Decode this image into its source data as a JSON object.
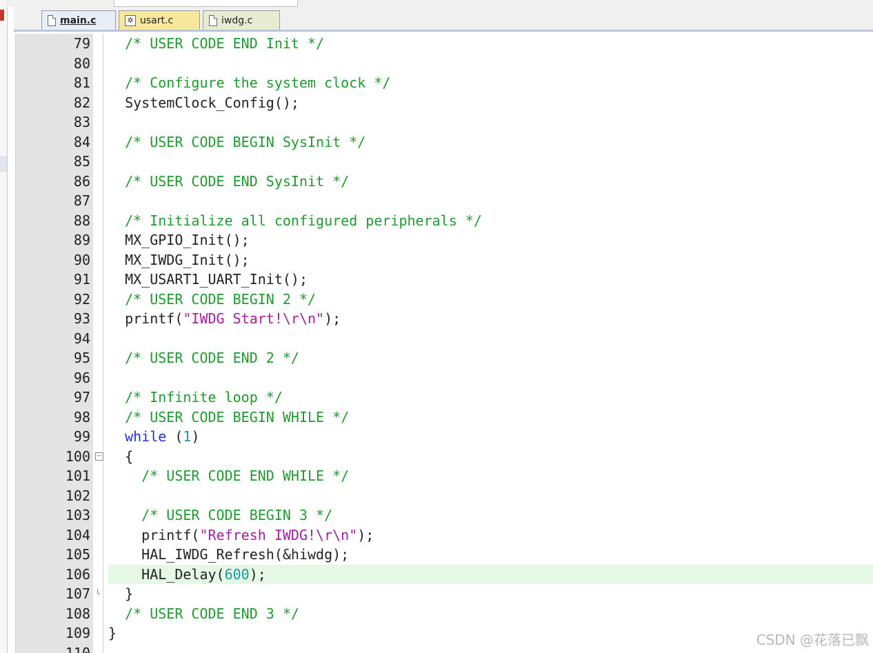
{
  "tabs": [
    {
      "label": "main.c",
      "icon": "file-icon",
      "active": true
    },
    {
      "label": "usart.c",
      "icon": "gear-file-icon",
      "active": false
    },
    {
      "label": "iwdg.c",
      "icon": "file-icon",
      "active": false
    }
  ],
  "editor": {
    "highlighted_line": 106,
    "lines": [
      {
        "num": "79",
        "fold": "",
        "tokens": [
          {
            "t": "  ",
            "k": "plain"
          },
          {
            "t": "/* USER CODE END Init */",
            "k": "comment"
          }
        ]
      },
      {
        "num": "80",
        "fold": "",
        "tokens": []
      },
      {
        "num": "81",
        "fold": "",
        "tokens": [
          {
            "t": "  ",
            "k": "plain"
          },
          {
            "t": "/* Configure the system clock */",
            "k": "comment"
          }
        ]
      },
      {
        "num": "82",
        "fold": "",
        "tokens": [
          {
            "t": "  SystemClock_Config();",
            "k": "plain"
          }
        ]
      },
      {
        "num": "83",
        "fold": "",
        "tokens": []
      },
      {
        "num": "84",
        "fold": "",
        "tokens": [
          {
            "t": "  ",
            "k": "plain"
          },
          {
            "t": "/* USER CODE BEGIN SysInit */",
            "k": "comment"
          }
        ]
      },
      {
        "num": "85",
        "fold": "",
        "tokens": []
      },
      {
        "num": "86",
        "fold": "",
        "tokens": [
          {
            "t": "  ",
            "k": "plain"
          },
          {
            "t": "/* USER CODE END SysInit */",
            "k": "comment"
          }
        ]
      },
      {
        "num": "87",
        "fold": "",
        "tokens": []
      },
      {
        "num": "88",
        "fold": "",
        "tokens": [
          {
            "t": "  ",
            "k": "plain"
          },
          {
            "t": "/* Initialize all configured peripherals */",
            "k": "comment"
          }
        ]
      },
      {
        "num": "89",
        "fold": "",
        "tokens": [
          {
            "t": "  MX_GPIO_Init();",
            "k": "plain"
          }
        ]
      },
      {
        "num": "90",
        "fold": "",
        "tokens": [
          {
            "t": "  MX_IWDG_Init();",
            "k": "plain"
          }
        ]
      },
      {
        "num": "91",
        "fold": "",
        "tokens": [
          {
            "t": "  MX_USART1_UART_Init();",
            "k": "plain"
          }
        ]
      },
      {
        "num": "92",
        "fold": "",
        "tokens": [
          {
            "t": "  ",
            "k": "plain"
          },
          {
            "t": "/* USER CODE BEGIN 2 */",
            "k": "comment"
          }
        ]
      },
      {
        "num": "93",
        "fold": "",
        "tokens": [
          {
            "t": "  printf(",
            "k": "plain"
          },
          {
            "t": "\"IWDG Start!\\r\\n\"",
            "k": "string"
          },
          {
            "t": ");",
            "k": "plain"
          }
        ]
      },
      {
        "num": "94",
        "fold": "",
        "tokens": []
      },
      {
        "num": "95",
        "fold": "",
        "tokens": [
          {
            "t": "  ",
            "k": "plain"
          },
          {
            "t": "/* USER CODE END 2 */",
            "k": "comment"
          }
        ]
      },
      {
        "num": "96",
        "fold": "",
        "tokens": []
      },
      {
        "num": "97",
        "fold": "",
        "tokens": [
          {
            "t": "  ",
            "k": "plain"
          },
          {
            "t": "/* Infinite loop */",
            "k": "comment"
          }
        ]
      },
      {
        "num": "98",
        "fold": "",
        "tokens": [
          {
            "t": "  ",
            "k": "plain"
          },
          {
            "t": "/* USER CODE BEGIN WHILE */",
            "k": "comment"
          }
        ]
      },
      {
        "num": "99",
        "fold": "",
        "tokens": [
          {
            "t": "  ",
            "k": "plain"
          },
          {
            "t": "while",
            "k": "keyword"
          },
          {
            "t": " (",
            "k": "plain"
          },
          {
            "t": "1",
            "k": "number"
          },
          {
            "t": ")",
            "k": "plain"
          }
        ]
      },
      {
        "num": "100",
        "fold": "box",
        "tokens": [
          {
            "t": "  {",
            "k": "plain"
          }
        ]
      },
      {
        "num": "101",
        "fold": "",
        "tokens": [
          {
            "t": "    ",
            "k": "plain"
          },
          {
            "t": "/* USER CODE END WHILE */",
            "k": "comment"
          }
        ]
      },
      {
        "num": "102",
        "fold": "",
        "tokens": []
      },
      {
        "num": "103",
        "fold": "",
        "tokens": [
          {
            "t": "    ",
            "k": "plain"
          },
          {
            "t": "/* USER CODE BEGIN 3 */",
            "k": "comment"
          }
        ]
      },
      {
        "num": "104",
        "fold": "",
        "tokens": [
          {
            "t": "    printf(",
            "k": "plain"
          },
          {
            "t": "\"Refresh IWDG!\\r\\n\"",
            "k": "string"
          },
          {
            "t": ");",
            "k": "plain"
          }
        ]
      },
      {
        "num": "105",
        "fold": "",
        "tokens": [
          {
            "t": "    HAL_IWDG_Refresh(&hiwdg);",
            "k": "plain"
          }
        ]
      },
      {
        "num": "106",
        "fold": "",
        "tokens": [
          {
            "t": "    HAL_Delay(",
            "k": "plain"
          },
          {
            "t": "600",
            "k": "number"
          },
          {
            "t": ");",
            "k": "plain"
          }
        ]
      },
      {
        "num": "107",
        "fold": "end",
        "tokens": [
          {
            "t": "  }",
            "k": "plain"
          }
        ]
      },
      {
        "num": "108",
        "fold": "",
        "tokens": [
          {
            "t": "  ",
            "k": "plain"
          },
          {
            "t": "/* USER CODE END 3 */",
            "k": "comment"
          }
        ]
      },
      {
        "num": "109",
        "fold": "",
        "tokens": [
          {
            "t": "}",
            "k": "plain"
          }
        ]
      },
      {
        "num": "110",
        "fold": "",
        "tokens": []
      }
    ]
  },
  "watermark": "CSDN @花落已飘",
  "colors": {
    "comment": "#1f9a2e",
    "keyword": "#2030e0",
    "string": "#a020a0",
    "number": "#1a9aa0",
    "highlight": "#e5f8e5"
  }
}
